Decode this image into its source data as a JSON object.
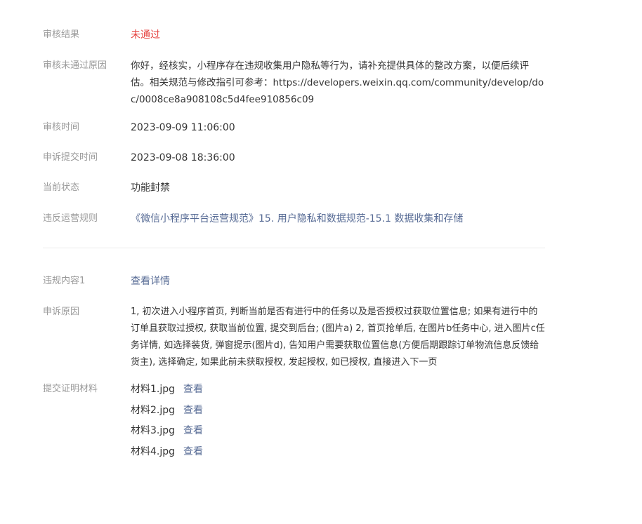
{
  "review": {
    "result_label": "审核结果",
    "result_value": "未通过",
    "reason_label": "审核未通过原因",
    "reason_value": "你好，经核实，小程序存在违规收集用户隐私等行为，请补充提供具体的整改方案，以便后续评估。相关规范与修改指引可参考：https://developers.weixin.qq.com/community/develop/doc/0008ce8a908108c5d4fee910856c09",
    "time_label": "审核时间",
    "time_value": "2023-09-09 11:06:00",
    "appeal_time_label": "申诉提交时间",
    "appeal_time_value": "2023-09-08 18:36:00",
    "status_label": "当前状态",
    "status_value": "功能封禁",
    "rule_label": "违反运营规则",
    "rule_value": "《微信小程序平台运营规范》15. 用户隐私和数据规范-15.1 数据收集和存储"
  },
  "violation": {
    "content_label": "违规内容1",
    "content_link": "查看详情",
    "appeal_reason_label": "申诉原因",
    "appeal_reason_value": "1, 初次进入小程序首页, 判断当前是否有进行中的任务以及是否授权过获取位置信息; 如果有进行中的订单且获取过授权, 获取当前位置, 提交到后台; (图片a) 2, 首页抢单后, 在图片b任务中心, 进入图片c任务详情, 如选择装货, 弹窗提示(图片d), 告知用户需要获取位置信息(方便后期跟踪订单物流信息反馈给货主), 选择确定, 如果此前未获取授权, 发起授权, 如已授权, 直接进入下一页",
    "materials_label": "提交证明材料",
    "materials": [
      {
        "name": "材料1.jpg",
        "view": "查看"
      },
      {
        "name": "材料2.jpg",
        "view": "查看"
      },
      {
        "name": "材料3.jpg",
        "view": "查看"
      },
      {
        "name": "材料4.jpg",
        "view": "查看"
      }
    ]
  },
  "colors": {
    "failed": "#e64340",
    "link": "#576b95",
    "label": "#9a9a9a",
    "text": "#353535"
  }
}
